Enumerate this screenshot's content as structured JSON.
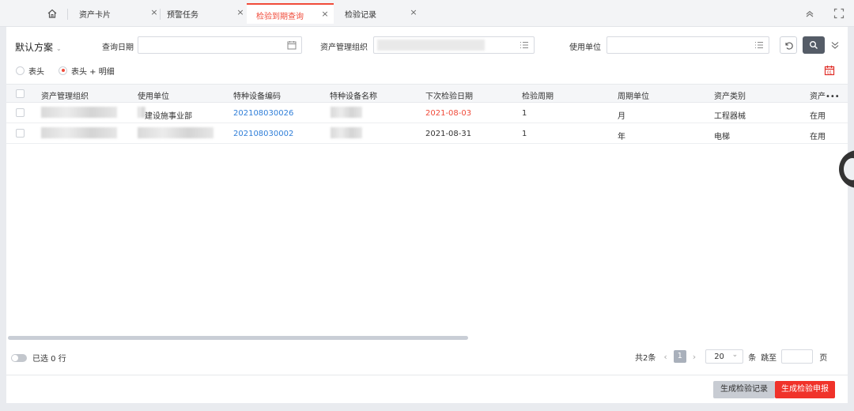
{
  "tabs": [
    {
      "label": "资产卡片",
      "closable": true
    },
    {
      "label": "预警任务",
      "closable": true
    },
    {
      "label": "检验到期查询",
      "closable": true,
      "active": true
    },
    {
      "label": "检验记录",
      "closable": true
    }
  ],
  "icons": {
    "home": "home-icon",
    "close": "×",
    "collapse": "chevron-up-icon",
    "fullscreen": "fullscreen-icon"
  },
  "filters": {
    "plan_label": "默认方案",
    "query_date_label": "查询日期",
    "asset_org_label": "资产管理组织",
    "use_unit_label": "使用单位"
  },
  "view_mode": {
    "options": [
      "表头",
      "表头 + 明细"
    ],
    "selected": "表头 + 明细"
  },
  "table": {
    "columns": [
      "资产管理组织",
      "使用单位",
      "特种设备编码",
      "特种设备名称",
      "下次检验日期",
      "检验周期",
      "周期单位",
      "资产类别",
      "资产•••"
    ],
    "rows": [
      {
        "use_unit": "建设施事业部",
        "code": "202108030026",
        "next_date": "2021-08-03",
        "cycle": "1",
        "unit": "月",
        "category": "工程器械",
        "status": "在用",
        "overdue": true
      },
      {
        "use_unit": "",
        "code": "202108030002",
        "next_date": "2021-08-31",
        "cycle": "1",
        "unit": "年",
        "category": "电梯",
        "status": "在用",
        "overdue": false
      }
    ]
  },
  "footer": {
    "selected_text": "已选 0 行",
    "total_text": "共2条",
    "current_page": "1",
    "page_size": "20",
    "page_size_unit": "条",
    "jump_label": "跳至",
    "page_label": "页"
  },
  "actions": {
    "generate_record": "生成检验记录",
    "generate_report": "生成检验申报"
  },
  "colors": {
    "accent": "#f04b3a",
    "link": "#2f7ed8",
    "primary_dark": "#555c67"
  }
}
